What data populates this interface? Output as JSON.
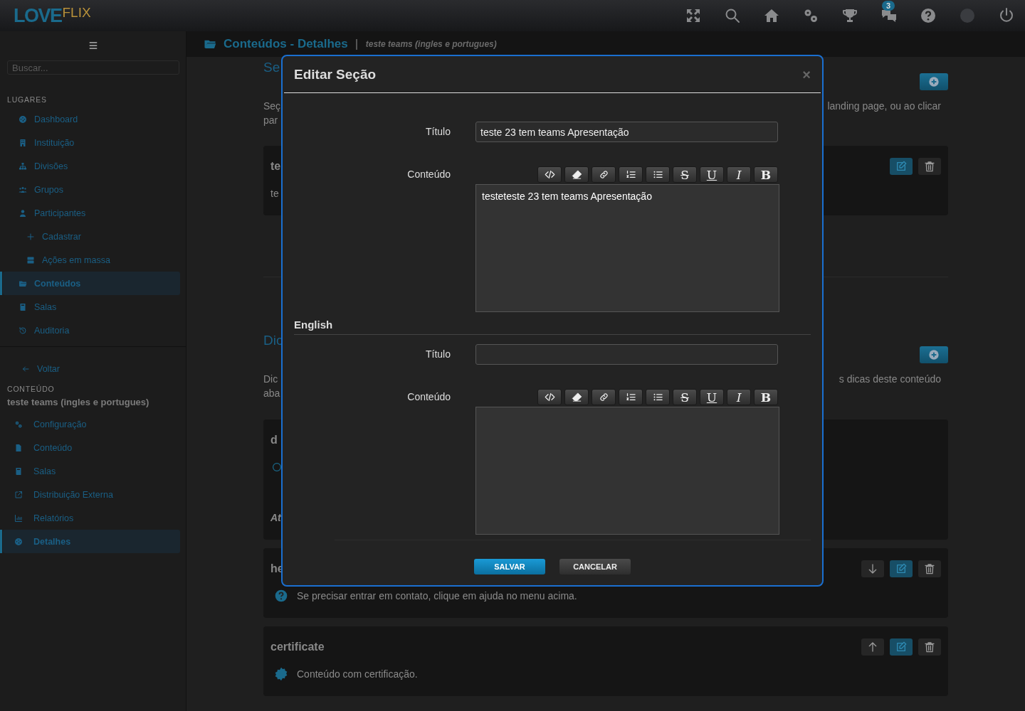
{
  "topbar": {
    "logo": {
      "main": "LOVE",
      "accent": "FLIX"
    },
    "icons": [
      {
        "kind": "expand"
      },
      {
        "kind": "search"
      },
      {
        "kind": "home"
      },
      {
        "kind": "gears"
      },
      {
        "kind": "trophy"
      },
      {
        "kind": "chat",
        "badge": "3"
      },
      {
        "kind": "help"
      },
      {
        "kind": "avatar"
      },
      {
        "kind": "power"
      }
    ]
  },
  "sidebar": {
    "search": {
      "placeholder": "Buscar..."
    },
    "section_label": "LUGARES",
    "items": [
      {
        "label": "Dashboard",
        "kind": "gauge",
        "selected": false
      },
      {
        "label": "Instituição",
        "kind": "building",
        "selected": false
      },
      {
        "label": "Divisões",
        "kind": "sitemap",
        "selected": false
      },
      {
        "label": "Grupos",
        "kind": "users",
        "selected": false
      },
      {
        "label": "Participantes",
        "kind": "user",
        "selected": false,
        "children": [
          {
            "label": "Cadastrar",
            "kind": "plus",
            "selected": false
          },
          {
            "label": "Ações em massa",
            "kind": "server",
            "selected": false
          }
        ]
      },
      {
        "label": "Conteúdos",
        "kind": "folder",
        "selected": true
      },
      {
        "label": "Salas",
        "kind": "book",
        "selected": false
      },
      {
        "label": "Auditoria",
        "kind": "history",
        "selected": false
      }
    ]
  },
  "content_nav": {
    "back": "Voltar",
    "section_label": "CONTEÚDO",
    "title": "teste teams (ingles e portugues)",
    "items": [
      {
        "label": "Configuração",
        "kind": "gears",
        "selected": false
      },
      {
        "label": "Conteúdo",
        "kind": "file",
        "selected": false
      },
      {
        "label": "Salas",
        "kind": "book",
        "selected": false
      },
      {
        "label": "Distribuição Externa",
        "kind": "external",
        "selected": false
      },
      {
        "label": "Relatórios",
        "kind": "chart",
        "selected": false
      },
      {
        "label": "Detalhes",
        "kind": "gauge",
        "selected": true
      }
    ]
  },
  "breadcrumb": {
    "title": "Conteúdos - Detalhes",
    "subtitle": "teste teams (ingles e portugues)"
  },
  "sections": [
    {
      "heading": "Se",
      "intro_left": [
        "Seç",
        "par"
      ],
      "intro_right": "landing page, ou ao clicar",
      "cards": [
        {
          "title": "te",
          "actions": [
            {
              "kind": "edit"
            },
            {
              "kind": "delete"
            }
          ],
          "lines": [
            {
              "kind": "text",
              "text": "te"
            }
          ]
        }
      ]
    },
    {
      "heading": "Dic",
      "intro_left": [
        "Dic",
        "aba"
      ],
      "intro_right": "s dicas deste conteúdo",
      "cards": [
        {
          "title": "d",
          "lines": [
            {
              "kind": "ring"
            },
            {
              "kind": "emphasis",
              "text": "At"
            }
          ]
        },
        {
          "title": "he",
          "actions": [
            {
              "kind": "down"
            },
            {
              "kind": "edit"
            },
            {
              "kind": "delete"
            }
          ],
          "lines": [
            {
              "kind": "help",
              "text": "Se precisar entrar em contato, clique em ajuda no menu acima."
            }
          ]
        },
        {
          "title": "certificate",
          "actions": [
            {
              "kind": "up"
            },
            {
              "kind": "edit"
            },
            {
              "kind": "delete"
            }
          ],
          "lines": [
            {
              "kind": "badge",
              "text": "Conteúdo com certificação."
            }
          ]
        }
      ]
    }
  ],
  "modal": {
    "title": "Editar Seção",
    "close": "×",
    "groups": [
      {
        "fields": [
          {
            "label": "Título",
            "kind": "text",
            "value": "teste 23 tem teams Apresentação"
          },
          {
            "label": "Conteúdo",
            "kind": "rich",
            "value": "testeteste 23 tem teams Apresentação",
            "toolbar": [
              {
                "kind": "code"
              },
              {
                "kind": "eraser"
              },
              {
                "kind": "link"
              },
              {
                "kind": "olist"
              },
              {
                "kind": "ulist"
              },
              {
                "kind": "strike",
                "label": "S"
              },
              {
                "kind": "underline",
                "label": "U"
              },
              {
                "kind": "italic",
                "label": "I"
              },
              {
                "kind": "bold",
                "label": "B"
              }
            ]
          }
        ]
      },
      {
        "heading": "English",
        "fields": [
          {
            "label": "Título",
            "kind": "text"
          },
          {
            "label": "Conteúdo",
            "kind": "rich",
            "toolbar": [
              {
                "kind": "code"
              },
              {
                "kind": "eraser"
              },
              {
                "kind": "link"
              },
              {
                "kind": "olist"
              },
              {
                "kind": "ulist"
              },
              {
                "kind": "strike",
                "label": "S"
              },
              {
                "kind": "underline",
                "label": "U"
              },
              {
                "kind": "italic",
                "label": "I"
              },
              {
                "kind": "bold",
                "label": "B"
              }
            ]
          }
        ]
      }
    ],
    "buttons": [
      {
        "label": "SALVAR",
        "kind": "primary"
      },
      {
        "label": "CANCELAR",
        "kind": "secondary"
      }
    ]
  }
}
